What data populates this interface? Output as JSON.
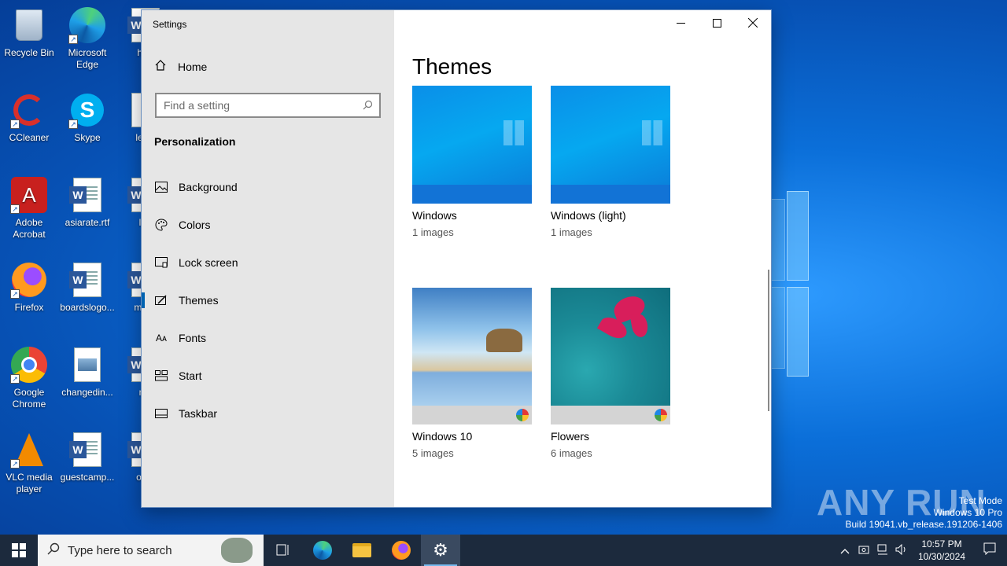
{
  "desktop": {
    "icons": [
      {
        "label": "Recycle Bin"
      },
      {
        "label": "Microsoft Edge"
      },
      {
        "label": "hilib"
      },
      {
        "label": "CCleaner"
      },
      {
        "label": "Skype"
      },
      {
        "label": "leadi"
      },
      {
        "label": "Adobe Acrobat"
      },
      {
        "label": "asiarate.rtf"
      },
      {
        "label": "lotr"
      },
      {
        "label": "Firefox"
      },
      {
        "label": "boardslogo..."
      },
      {
        "label": "maca"
      },
      {
        "label": "Google Chrome"
      },
      {
        "label": "changedin..."
      },
      {
        "label": "mg"
      },
      {
        "label": "VLC media player"
      },
      {
        "label": "guestcamp..."
      },
      {
        "label": "offer"
      }
    ]
  },
  "window": {
    "title": "Settings",
    "home_label": "Home",
    "search_placeholder": "Find a setting",
    "section_title": "Personalization",
    "nav_items": [
      {
        "label": "Background",
        "icon": "image-icon"
      },
      {
        "label": "Colors",
        "icon": "palette-icon"
      },
      {
        "label": "Lock screen",
        "icon": "lock-screen-icon"
      },
      {
        "label": "Themes",
        "icon": "brush-icon",
        "active": true
      },
      {
        "label": "Fonts",
        "icon": "fonts-icon"
      },
      {
        "label": "Start",
        "icon": "start-icon"
      },
      {
        "label": "Taskbar",
        "icon": "taskbar-icon"
      }
    ],
    "page_title": "Themes",
    "themes": [
      {
        "name": "Windows",
        "count": "1 images"
      },
      {
        "name": "Windows (light)",
        "count": "1 images"
      },
      {
        "name": "Windows 10",
        "count": "5 images"
      },
      {
        "name": "Flowers",
        "count": "6 images"
      }
    ],
    "accent_color": "#0063b1"
  },
  "watermark": {
    "brand": "ANY RUN",
    "line1": "Test Mode",
    "line2": "Windows 10 Pro",
    "line3": "Build 19041.vb_release.191206-1406"
  },
  "taskbar": {
    "search_placeholder": "Type here to search",
    "time": "10:57 PM",
    "date": "10/30/2024"
  }
}
